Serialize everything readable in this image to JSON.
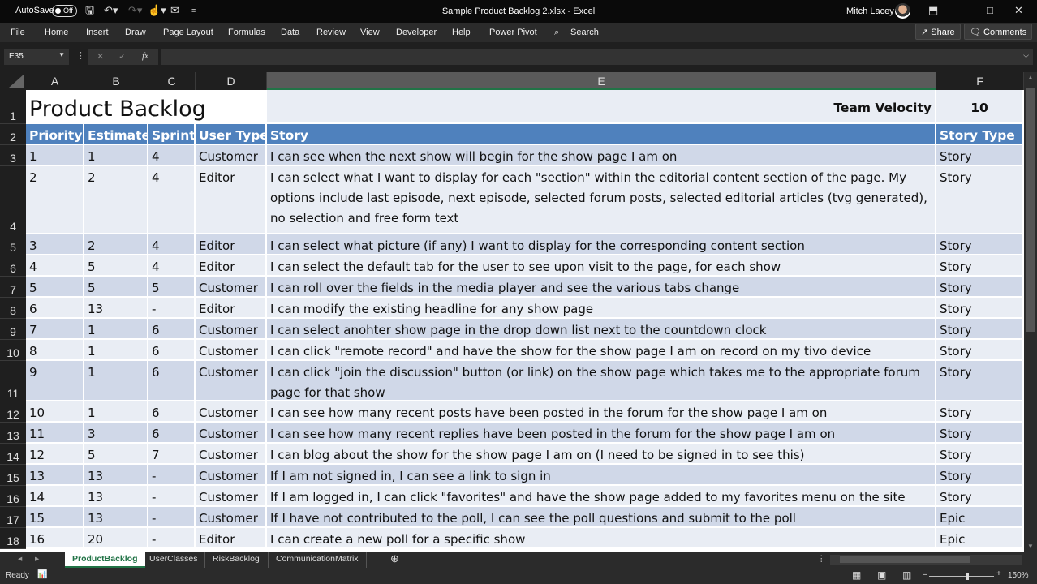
{
  "titlebar": {
    "autosave_label": "AutoSave",
    "autosave_state": "Off",
    "document_title": "Sample Product Backlog 2.xlsx  -  Excel",
    "user_name": "Mitch Lacey"
  },
  "menu": {
    "items": [
      "File",
      "Home",
      "Insert",
      "Draw",
      "Page Layout",
      "Formulas",
      "Data",
      "Review",
      "View",
      "Developer",
      "Help",
      "Power Pivot"
    ],
    "search_label": "Search",
    "share_label": "Share",
    "comments_label": "Comments"
  },
  "formula_bar": {
    "name_box": "E35",
    "formula": "",
    "fx_label": "fx"
  },
  "columns": [
    "A",
    "B",
    "C",
    "D",
    "E",
    "F"
  ],
  "selected_column": "E",
  "sheet": {
    "title": "Product Backlog",
    "velocity_label": "Team Velocity",
    "velocity_value": "10",
    "headers": [
      "Priority",
      "Estimate",
      "Sprint",
      "User Type",
      "Story",
      "Story Type"
    ],
    "rows": [
      {
        "row": "3",
        "priority": "1",
        "estimate": "1",
        "sprint": "4",
        "user_type": "Customer",
        "story": "I can see when the next show will begin for the show page I am on",
        "story_type": "Story"
      },
      {
        "row": "4",
        "priority": "2",
        "estimate": "2",
        "sprint": "4",
        "user_type": "Editor",
        "story": "I can select what I want to display for each \"section\" within the editorial content section of the page.  My options include last episode, next episode, selected forum posts, selected editorial articles (tvg generated), no selection and free form text",
        "story_type": "Story"
      },
      {
        "row": "5",
        "priority": "3",
        "estimate": "2",
        "sprint": "4",
        "user_type": "Editor",
        "story": "I can select what picture (if any) I want to display for the corresponding content section",
        "story_type": "Story"
      },
      {
        "row": "6",
        "priority": "4",
        "estimate": "5",
        "sprint": "4",
        "user_type": "Editor",
        "story": "I can select the default tab for the user to see upon visit to the page, for each show",
        "story_type": "Story"
      },
      {
        "row": "7",
        "priority": "5",
        "estimate": "5",
        "sprint": "5",
        "user_type": "Customer",
        "story": "I can roll over the fields in the media player and see the various tabs change",
        "story_type": "Story"
      },
      {
        "row": "8",
        "priority": "6",
        "estimate": "13",
        "sprint": "-",
        "user_type": "Editor",
        "story": "I can modify the existing headline for any show page",
        "story_type": "Story"
      },
      {
        "row": "9",
        "priority": "7",
        "estimate": "1",
        "sprint": "6",
        "user_type": "Customer",
        "story": "I can select anohter show page in the drop down list next to the countdown clock",
        "story_type": "Story"
      },
      {
        "row": "10",
        "priority": "8",
        "estimate": "1",
        "sprint": "6",
        "user_type": "Customer",
        "story": "I can click \"remote record\" and have the show for the show page I am on record on my tivo device",
        "story_type": "Story"
      },
      {
        "row": "11",
        "priority": "9",
        "estimate": "1",
        "sprint": "6",
        "user_type": "Customer",
        "story": "I can click \"join the discussion\" button (or link) on the show page which takes me to the appropriate forum page for that show",
        "story_type": "Story"
      },
      {
        "row": "12",
        "priority": "10",
        "estimate": "1",
        "sprint": "6",
        "user_type": "Customer",
        "story": "I can see how many recent posts have been posted in the forum for the show page I am on",
        "story_type": "Story"
      },
      {
        "row": "13",
        "priority": "11",
        "estimate": "3",
        "sprint": "6",
        "user_type": "Customer",
        "story": "I can see how many recent replies have been posted in the forum for the show page I am on",
        "story_type": "Story"
      },
      {
        "row": "14",
        "priority": "12",
        "estimate": "5",
        "sprint": "7",
        "user_type": "Customer",
        "story": "I can blog about the show for the show page I am on (I need to be signed in to see this)",
        "story_type": "Story"
      },
      {
        "row": "15",
        "priority": "13",
        "estimate": "13",
        "sprint": "-",
        "user_type": "Customer",
        "story": "If I am not signed in, I can see a link to sign in",
        "story_type": "Story"
      },
      {
        "row": "16",
        "priority": "14",
        "estimate": "13",
        "sprint": "-",
        "user_type": "Customer",
        "story": "If I am logged in, I can click \"favorites\" and have the show page added to my favorites menu on the site",
        "story_type": "Story"
      },
      {
        "row": "17",
        "priority": "15",
        "estimate": "13",
        "sprint": "-",
        "user_type": "Customer",
        "story": "If I have not contributed to the poll, I can see the poll questions and submit to the poll",
        "story_type": "Epic"
      },
      {
        "row": "18",
        "priority": "16",
        "estimate": "20",
        "sprint": "-",
        "user_type": "Editor",
        "story": "I can create a new poll for a specific show",
        "story_type": "Epic"
      }
    ]
  },
  "sheet_tabs": [
    "ProductBacklog",
    "UserClasses",
    "RiskBacklog",
    "CommunicationMatrix"
  ],
  "active_tab": "ProductBacklog",
  "status": {
    "ready_label": "Ready",
    "zoom_label": "150%",
    "zoom_percent": 150
  },
  "colors": {
    "header_blue": "#4f81bd",
    "band_light": "#e9edf4",
    "band_dark": "#d0d8e8",
    "excel_green": "#217346"
  }
}
